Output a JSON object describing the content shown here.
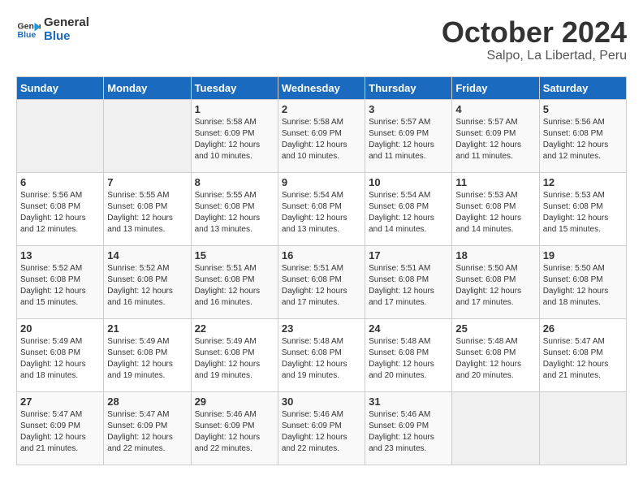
{
  "header": {
    "logo_line1": "General",
    "logo_line2": "Blue",
    "month": "October 2024",
    "location": "Salpo, La Libertad, Peru"
  },
  "days_of_week": [
    "Sunday",
    "Monday",
    "Tuesday",
    "Wednesday",
    "Thursday",
    "Friday",
    "Saturday"
  ],
  "weeks": [
    [
      {
        "day": "",
        "empty": true
      },
      {
        "day": "",
        "empty": true
      },
      {
        "day": "1",
        "sunrise": "5:58 AM",
        "sunset": "6:09 PM",
        "daylight": "12 hours and 10 minutes."
      },
      {
        "day": "2",
        "sunrise": "5:58 AM",
        "sunset": "6:09 PM",
        "daylight": "12 hours and 10 minutes."
      },
      {
        "day": "3",
        "sunrise": "5:57 AM",
        "sunset": "6:09 PM",
        "daylight": "12 hours and 11 minutes."
      },
      {
        "day": "4",
        "sunrise": "5:57 AM",
        "sunset": "6:09 PM",
        "daylight": "12 hours and 11 minutes."
      },
      {
        "day": "5",
        "sunrise": "5:56 AM",
        "sunset": "6:08 PM",
        "daylight": "12 hours and 12 minutes."
      }
    ],
    [
      {
        "day": "6",
        "sunrise": "5:56 AM",
        "sunset": "6:08 PM",
        "daylight": "12 hours and 12 minutes."
      },
      {
        "day": "7",
        "sunrise": "5:55 AM",
        "sunset": "6:08 PM",
        "daylight": "12 hours and 13 minutes."
      },
      {
        "day": "8",
        "sunrise": "5:55 AM",
        "sunset": "6:08 PM",
        "daylight": "12 hours and 13 minutes."
      },
      {
        "day": "9",
        "sunrise": "5:54 AM",
        "sunset": "6:08 PM",
        "daylight": "12 hours and 13 minutes."
      },
      {
        "day": "10",
        "sunrise": "5:54 AM",
        "sunset": "6:08 PM",
        "daylight": "12 hours and 14 minutes."
      },
      {
        "day": "11",
        "sunrise": "5:53 AM",
        "sunset": "6:08 PM",
        "daylight": "12 hours and 14 minutes."
      },
      {
        "day": "12",
        "sunrise": "5:53 AM",
        "sunset": "6:08 PM",
        "daylight": "12 hours and 15 minutes."
      }
    ],
    [
      {
        "day": "13",
        "sunrise": "5:52 AM",
        "sunset": "6:08 PM",
        "daylight": "12 hours and 15 minutes."
      },
      {
        "day": "14",
        "sunrise": "5:52 AM",
        "sunset": "6:08 PM",
        "daylight": "12 hours and 16 minutes."
      },
      {
        "day": "15",
        "sunrise": "5:51 AM",
        "sunset": "6:08 PM",
        "daylight": "12 hours and 16 minutes."
      },
      {
        "day": "16",
        "sunrise": "5:51 AM",
        "sunset": "6:08 PM",
        "daylight": "12 hours and 17 minutes."
      },
      {
        "day": "17",
        "sunrise": "5:51 AM",
        "sunset": "6:08 PM",
        "daylight": "12 hours and 17 minutes."
      },
      {
        "day": "18",
        "sunrise": "5:50 AM",
        "sunset": "6:08 PM",
        "daylight": "12 hours and 17 minutes."
      },
      {
        "day": "19",
        "sunrise": "5:50 AM",
        "sunset": "6:08 PM",
        "daylight": "12 hours and 18 minutes."
      }
    ],
    [
      {
        "day": "20",
        "sunrise": "5:49 AM",
        "sunset": "6:08 PM",
        "daylight": "12 hours and 18 minutes."
      },
      {
        "day": "21",
        "sunrise": "5:49 AM",
        "sunset": "6:08 PM",
        "daylight": "12 hours and 19 minutes."
      },
      {
        "day": "22",
        "sunrise": "5:49 AM",
        "sunset": "6:08 PM",
        "daylight": "12 hours and 19 minutes."
      },
      {
        "day": "23",
        "sunrise": "5:48 AM",
        "sunset": "6:08 PM",
        "daylight": "12 hours and 19 minutes."
      },
      {
        "day": "24",
        "sunrise": "5:48 AM",
        "sunset": "6:08 PM",
        "daylight": "12 hours and 20 minutes."
      },
      {
        "day": "25",
        "sunrise": "5:48 AM",
        "sunset": "6:08 PM",
        "daylight": "12 hours and 20 minutes."
      },
      {
        "day": "26",
        "sunrise": "5:47 AM",
        "sunset": "6:08 PM",
        "daylight": "12 hours and 21 minutes."
      }
    ],
    [
      {
        "day": "27",
        "sunrise": "5:47 AM",
        "sunset": "6:09 PM",
        "daylight": "12 hours and 21 minutes."
      },
      {
        "day": "28",
        "sunrise": "5:47 AM",
        "sunset": "6:09 PM",
        "daylight": "12 hours and 22 minutes."
      },
      {
        "day": "29",
        "sunrise": "5:46 AM",
        "sunset": "6:09 PM",
        "daylight": "12 hours and 22 minutes."
      },
      {
        "day": "30",
        "sunrise": "5:46 AM",
        "sunset": "6:09 PM",
        "daylight": "12 hours and 22 minutes."
      },
      {
        "day": "31",
        "sunrise": "5:46 AM",
        "sunset": "6:09 PM",
        "daylight": "12 hours and 23 minutes."
      },
      {
        "day": "",
        "empty": true
      },
      {
        "day": "",
        "empty": true
      }
    ]
  ],
  "labels": {
    "sunrise_prefix": "Sunrise: ",
    "sunset_prefix": "Sunset: ",
    "daylight_prefix": "Daylight: "
  }
}
